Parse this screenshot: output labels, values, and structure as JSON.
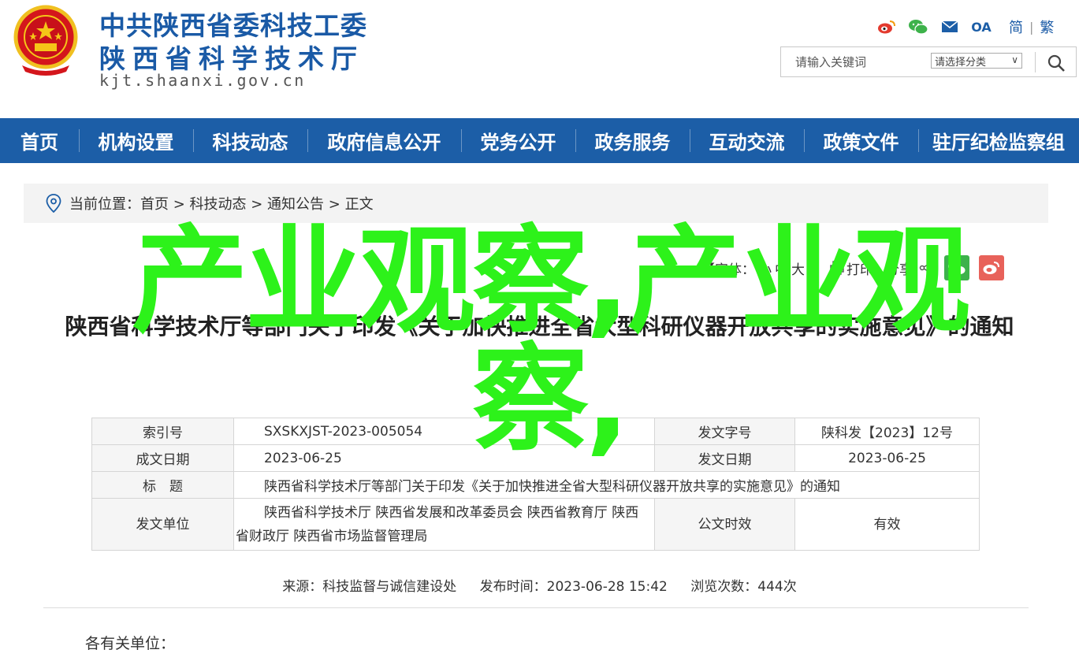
{
  "header": {
    "org_line_1": "中共陕西省委科技工委",
    "org_line_2": "陕西省科学技术厅",
    "domain": "kjt.shaanxi.gov.cn",
    "emblem_icon": "national-emblem-icon",
    "lang_simplified": "简",
    "lang_separator": "|",
    "lang_traditional": "繁",
    "oa_label": "OA"
  },
  "search": {
    "placeholder": "请输入关键词",
    "category_selected": "请选择分类"
  },
  "nav": {
    "items": [
      "首页",
      "机构设置",
      "科技动态",
      "政府信息公开",
      "党务公开",
      "政务服务",
      "互动交流",
      "政策文件",
      "驻厅纪检监察组"
    ]
  },
  "breadcrumb": {
    "prefix": "当前位置：",
    "path": "首页 > 科技动态 > 通知公告 > 正文"
  },
  "tools": {
    "font_label_open": "【字体：",
    "font_small": "小",
    "font_medium": "中",
    "font_large": "大",
    "font_label_close": "】",
    "print": "打印",
    "share": "分享"
  },
  "article": {
    "title": "陕西省科学技术厅等部门关于印发《关于加快推进全省大型科研仪器开放共享的实施意见》的通知"
  },
  "overlay_text": "产业观察,产业观察,",
  "info_table": {
    "index_label": "索引号",
    "index_value": "SXSKXJST-2023-005054",
    "doc_no_label": "发文字号",
    "doc_no_value": "陕科发【2023】12号",
    "created_label": "成文日期",
    "created_value": "2023-06-25",
    "issued_label": "发文日期",
    "issued_value": "2023-06-25",
    "title_label": "标　题",
    "title_value": "陕西省科学技术厅等部门关于印发《关于加快推进全省大型科研仪器开放共享的实施意见》的通知",
    "issuer_label": "发文单位",
    "issuer_value": "陕西省科学技术厅 陕西省发展和改革委员会 陕西省教育厅 陕西省财政厅 陕西省市场监督管理局",
    "validity_label": "公文时效",
    "validity_value": "有效"
  },
  "meta": {
    "source": "来源：科技监督与诚信建设处",
    "publish_time": "发布时间：2023-06-28 15:42",
    "views": "浏览次数：444次"
  },
  "body": {
    "salutation": "各有关单位："
  },
  "colors": {
    "brand_blue": "#1c5ea7",
    "overlay_green": "#2df21a",
    "wechat_green": "#3db24b",
    "weibo_red": "#e8625a"
  }
}
